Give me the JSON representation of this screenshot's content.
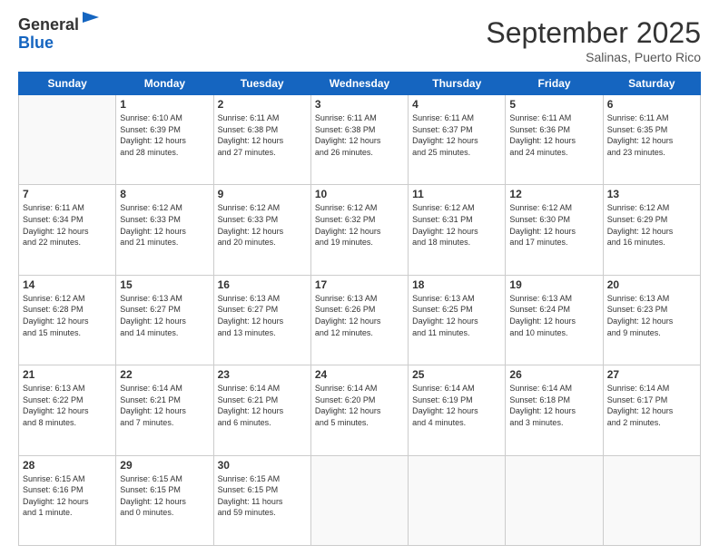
{
  "header": {
    "logo_general": "General",
    "logo_blue": "Blue",
    "month_title": "September 2025",
    "location": "Salinas, Puerto Rico"
  },
  "days_of_week": [
    "Sunday",
    "Monday",
    "Tuesday",
    "Wednesday",
    "Thursday",
    "Friday",
    "Saturday"
  ],
  "weeks": [
    [
      {
        "day": "",
        "info": ""
      },
      {
        "day": "1",
        "info": "Sunrise: 6:10 AM\nSunset: 6:39 PM\nDaylight: 12 hours\nand 28 minutes."
      },
      {
        "day": "2",
        "info": "Sunrise: 6:11 AM\nSunset: 6:38 PM\nDaylight: 12 hours\nand 27 minutes."
      },
      {
        "day": "3",
        "info": "Sunrise: 6:11 AM\nSunset: 6:38 PM\nDaylight: 12 hours\nand 26 minutes."
      },
      {
        "day": "4",
        "info": "Sunrise: 6:11 AM\nSunset: 6:37 PM\nDaylight: 12 hours\nand 25 minutes."
      },
      {
        "day": "5",
        "info": "Sunrise: 6:11 AM\nSunset: 6:36 PM\nDaylight: 12 hours\nand 24 minutes."
      },
      {
        "day": "6",
        "info": "Sunrise: 6:11 AM\nSunset: 6:35 PM\nDaylight: 12 hours\nand 23 minutes."
      }
    ],
    [
      {
        "day": "7",
        "info": "Sunrise: 6:11 AM\nSunset: 6:34 PM\nDaylight: 12 hours\nand 22 minutes."
      },
      {
        "day": "8",
        "info": "Sunrise: 6:12 AM\nSunset: 6:33 PM\nDaylight: 12 hours\nand 21 minutes."
      },
      {
        "day": "9",
        "info": "Sunrise: 6:12 AM\nSunset: 6:33 PM\nDaylight: 12 hours\nand 20 minutes."
      },
      {
        "day": "10",
        "info": "Sunrise: 6:12 AM\nSunset: 6:32 PM\nDaylight: 12 hours\nand 19 minutes."
      },
      {
        "day": "11",
        "info": "Sunrise: 6:12 AM\nSunset: 6:31 PM\nDaylight: 12 hours\nand 18 minutes."
      },
      {
        "day": "12",
        "info": "Sunrise: 6:12 AM\nSunset: 6:30 PM\nDaylight: 12 hours\nand 17 minutes."
      },
      {
        "day": "13",
        "info": "Sunrise: 6:12 AM\nSunset: 6:29 PM\nDaylight: 12 hours\nand 16 minutes."
      }
    ],
    [
      {
        "day": "14",
        "info": "Sunrise: 6:12 AM\nSunset: 6:28 PM\nDaylight: 12 hours\nand 15 minutes."
      },
      {
        "day": "15",
        "info": "Sunrise: 6:13 AM\nSunset: 6:27 PM\nDaylight: 12 hours\nand 14 minutes."
      },
      {
        "day": "16",
        "info": "Sunrise: 6:13 AM\nSunset: 6:27 PM\nDaylight: 12 hours\nand 13 minutes."
      },
      {
        "day": "17",
        "info": "Sunrise: 6:13 AM\nSunset: 6:26 PM\nDaylight: 12 hours\nand 12 minutes."
      },
      {
        "day": "18",
        "info": "Sunrise: 6:13 AM\nSunset: 6:25 PM\nDaylight: 12 hours\nand 11 minutes."
      },
      {
        "day": "19",
        "info": "Sunrise: 6:13 AM\nSunset: 6:24 PM\nDaylight: 12 hours\nand 10 minutes."
      },
      {
        "day": "20",
        "info": "Sunrise: 6:13 AM\nSunset: 6:23 PM\nDaylight: 12 hours\nand 9 minutes."
      }
    ],
    [
      {
        "day": "21",
        "info": "Sunrise: 6:13 AM\nSunset: 6:22 PM\nDaylight: 12 hours\nand 8 minutes."
      },
      {
        "day": "22",
        "info": "Sunrise: 6:14 AM\nSunset: 6:21 PM\nDaylight: 12 hours\nand 7 minutes."
      },
      {
        "day": "23",
        "info": "Sunrise: 6:14 AM\nSunset: 6:21 PM\nDaylight: 12 hours\nand 6 minutes."
      },
      {
        "day": "24",
        "info": "Sunrise: 6:14 AM\nSunset: 6:20 PM\nDaylight: 12 hours\nand 5 minutes."
      },
      {
        "day": "25",
        "info": "Sunrise: 6:14 AM\nSunset: 6:19 PM\nDaylight: 12 hours\nand 4 minutes."
      },
      {
        "day": "26",
        "info": "Sunrise: 6:14 AM\nSunset: 6:18 PM\nDaylight: 12 hours\nand 3 minutes."
      },
      {
        "day": "27",
        "info": "Sunrise: 6:14 AM\nSunset: 6:17 PM\nDaylight: 12 hours\nand 2 minutes."
      }
    ],
    [
      {
        "day": "28",
        "info": "Sunrise: 6:15 AM\nSunset: 6:16 PM\nDaylight: 12 hours\nand 1 minute."
      },
      {
        "day": "29",
        "info": "Sunrise: 6:15 AM\nSunset: 6:15 PM\nDaylight: 12 hours\nand 0 minutes."
      },
      {
        "day": "30",
        "info": "Sunrise: 6:15 AM\nSunset: 6:15 PM\nDaylight: 11 hours\nand 59 minutes."
      },
      {
        "day": "",
        "info": ""
      },
      {
        "day": "",
        "info": ""
      },
      {
        "day": "",
        "info": ""
      },
      {
        "day": "",
        "info": ""
      }
    ]
  ]
}
